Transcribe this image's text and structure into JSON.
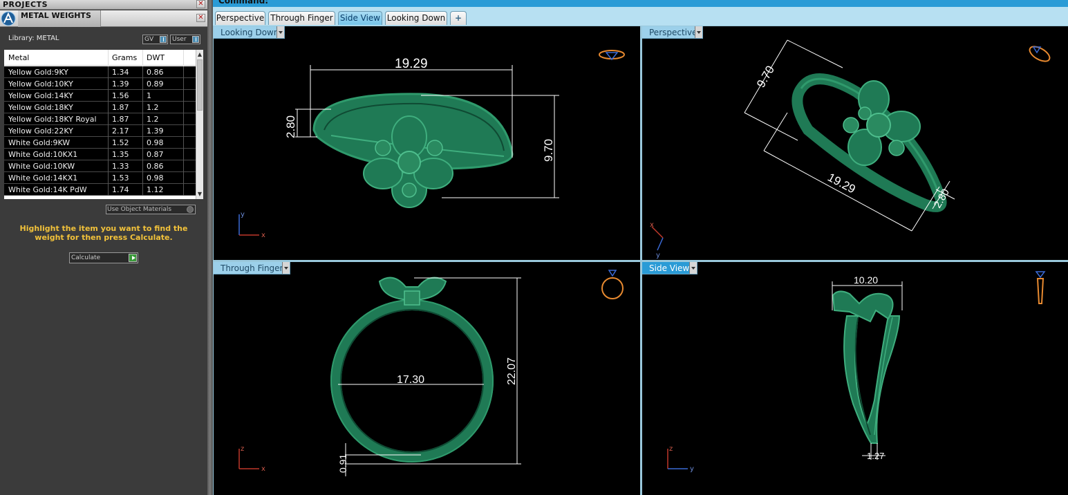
{
  "left_panel": {
    "projects_title": "PROJECTS",
    "metal_weights_title": "METAL WEIGHTS",
    "library_label": "Library: METAL",
    "gv_label": "GV",
    "user_label": "User",
    "table": {
      "headers": [
        "Metal",
        "Grams",
        "DWT"
      ],
      "rows": [
        [
          "Yellow Gold:9KY",
          "1.34",
          "0.86"
        ],
        [
          "Yellow Gold:10KY",
          "1.39",
          "0.89"
        ],
        [
          "Yellow Gold:14KY",
          "1.56",
          "1"
        ],
        [
          "Yellow Gold:18KY",
          "1.87",
          "1.2"
        ],
        [
          "Yellow Gold:18KY Royal",
          "1.87",
          "1.2"
        ],
        [
          "Yellow Gold:22KY",
          "2.17",
          "1.39"
        ],
        [
          "White Gold:9KW",
          "1.52",
          "0.98"
        ],
        [
          "White Gold:10KX1",
          "1.35",
          "0.87"
        ],
        [
          "White Gold:10KW",
          "1.33",
          "0.86"
        ],
        [
          "White Gold:14KX1",
          "1.53",
          "0.98"
        ],
        [
          "White Gold:14K PdW",
          "1.74",
          "1.12"
        ]
      ]
    },
    "use_object_materials": "Use Object Materials",
    "hint": "Highlight the item you want to find the weight for then press Calculate.",
    "calculate_label": "Calculate"
  },
  "command_label": "Command:",
  "tabs": [
    "Perspective",
    "Through Finger",
    "Side View",
    "Looking Down",
    "+"
  ],
  "active_tab": "Side View",
  "viewports": {
    "top_left": {
      "label": "Looking Down",
      "dims": {
        "width": "19.29",
        "height": "2.80",
        "depth": "9.70"
      },
      "axes": [
        "y",
        "x"
      ]
    },
    "top_right": {
      "label": "Perspective",
      "dims": {
        "a": "9.70",
        "b": "19.29",
        "c": "2.80"
      },
      "axes": [
        "x",
        "y"
      ]
    },
    "bottom_left": {
      "label": "Through Finger",
      "dims": {
        "diameter": "17.30",
        "height": "22.07",
        "thickness": "0.91"
      },
      "axes": [
        "z",
        "x"
      ]
    },
    "bottom_right": {
      "label": "Side View",
      "dims": {
        "width": "10.20",
        "base": "1.27"
      },
      "axes": [
        "z",
        "y"
      ]
    }
  },
  "colors": {
    "model_green": "#1f7a55",
    "model_light": "#2f9a6c",
    "viewport_bg": "#000000",
    "accent": "#2a9bd6",
    "hint_text": "#f2c23a"
  }
}
